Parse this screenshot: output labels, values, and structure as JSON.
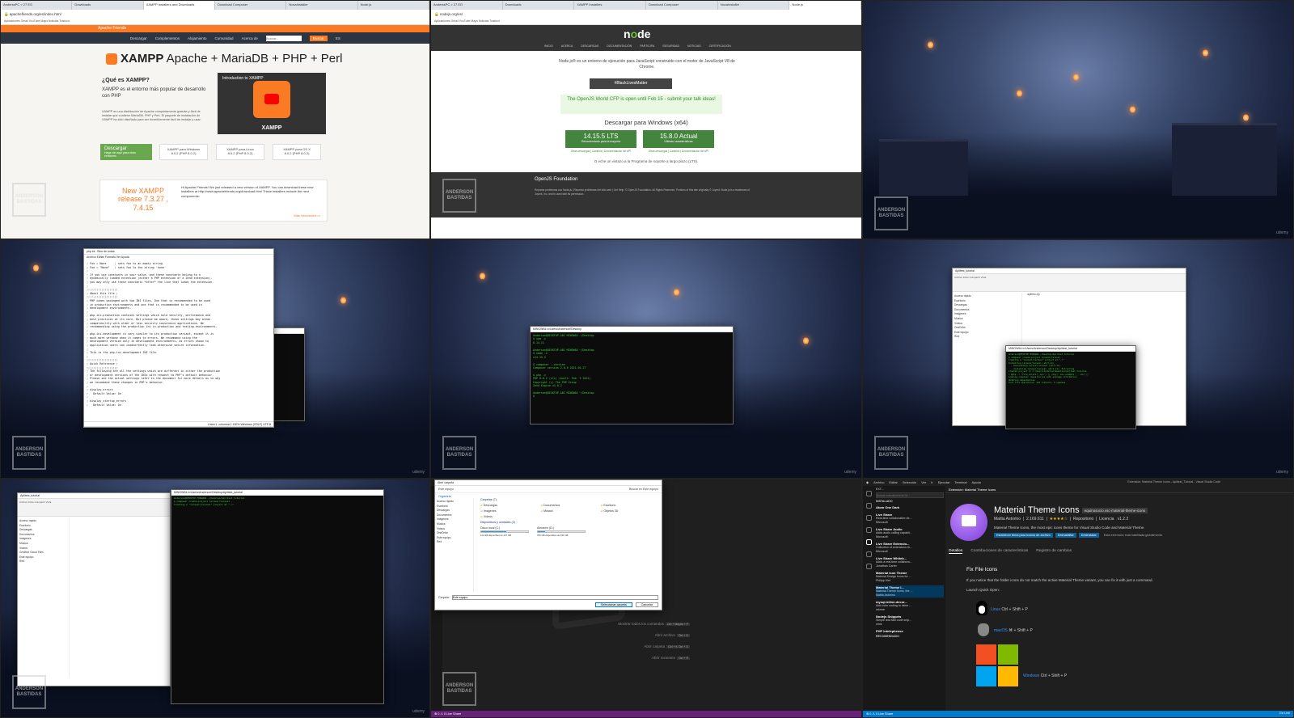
{
  "watermark": "ANDERSON BASTIDAS",
  "corner_brand": "udemy",
  "xampp": {
    "tabs": [
      "AnderssPC > 27 EG",
      "Downloads",
      "XAMPP Installers and Downloads",
      "Download Composer",
      "NovaInstaller",
      "Node.js"
    ],
    "url": "apachefriends.org/es/index.html",
    "bookmarks": "Aplicaciones  Gmail  YouTube  Maps  Noticias  Traducir",
    "top": "Apache Friends",
    "nav": [
      "Descargar",
      "Complementos",
      "Alojamiento",
      "Comunidad",
      "Acerca de"
    ],
    "search_placeholder": "Buscar...",
    "search_btn": "Buscar",
    "lang": "ES",
    "title_bold": "XAMPP",
    "title_rest": " Apache + MariaDB + PHP + Perl",
    "question": "¿Qué es XAMPP?",
    "lead": "XAMPP es el entorno más popular de desarrollo con PHP",
    "body": "XAMPP es una distribución de Apache completamente gratuita y fácil de instalar que contiene MariaDB, PHP y Perl. El paquete de instalación de XAMPP ha sido diseñado para ser increíblemente fácil de instalar y usar.",
    "video_title": "Introduction to XAMPP",
    "video_caption": "XAMPP",
    "download": "Descargar",
    "download_sub": "Haga clic aquí para otras versiones",
    "os": [
      {
        "name": "XAMPP para Windows",
        "ver": "8.0.2 (PHP 8.0.2)"
      },
      {
        "name": "XAMPP para Linux",
        "ver": "8.0.2 (PHP 8.0.2)"
      },
      {
        "name": "XAMPP para OS X",
        "ver": "8.0.2 (PHP 8.0.2)"
      }
    ],
    "release": "New XAMPP release 7.3.27 , 7.4.15",
    "news": "Hi Apache Friends! We just released a new version of XAMPP. You can download these new installers at http://www.apachefriends.org/download.html These installers include the next components:",
    "more": "Más información »"
  },
  "node": {
    "tabs": [
      "AnderssPC > 27 EG",
      "Downloads",
      "XAMPP Installers",
      "Download Composer",
      "NovaInstaller",
      "Node.js"
    ],
    "url": "nodejs.org/es/",
    "logo_a": "n",
    "logo_o": "o",
    "logo_b": "de",
    "nav": [
      "INICIO",
      "ACERCA",
      "DESCARGAS",
      "DOCUMENTACIÓN",
      "PARTICIPA",
      "SEGURIDAD",
      "NOTICIAS",
      "CERTIFICACIÓN"
    ],
    "desc": "Node.js® es un entorno de ejecución para JavaScript construido con el motor de JavaScript V8 de Chrome.",
    "blm": "#BlackLivesMatter",
    "banner": "The OpenJS World CFP is open until Feb 15 - submit your talk ideas!",
    "dl_title": "Descargar para Windows (x64)",
    "lts": "14.15.5 LTS",
    "lts_sub": "Recomendado para la mayoría",
    "cur": "15.8.0 Actual",
    "cur_sub": "Últimas características",
    "lts_links": "Otras descargas | Cambios | Documentación del API",
    "cur_links": "Otras descargas | Cambios | Documentación del API",
    "alt": "O eche un vistazo a la Programa de soporte a largo plazo (LTS).",
    "foot_brand": "OpenJS Foundation",
    "foot_text": "Reportar problemas con Node.js | Reportar problemas del sitio web | Get Help. © OpenJS Foundation. All Rights Reserved. Portions of this site originally © Joyent. Node.js is a trademark of Joyent, Inc. and is used with its permission."
  },
  "notepad": {
    "title": "php.ini - Bloc de notas",
    "menu": "Archivo  Editar  Formato  Ver  Ayuda",
    "lines": "; Foo = None     ; sets foo to an empty string\n; Foo = \"None\"   ; sets foo to the string 'none'\n;\n; If you use constants in your value, and these constants belong to a\n; dynamically loaded extension (either a PHP extension or a Zend extension),\n; you may only use these constants *after* the line that loads the extension.\n;\n;;;;;;;;;;;;;;;;;;;\n; About this file ;\n;;;;;;;;;;;;;;;;;;;\n; PHP comes packaged with two INI files. One that is recommended to be used\n; in production environments and one that is recommended to be used in\n; development environments.\n;\n; php.ini-production contains settings which hold security, performance and\n; best practices at its core. But please be aware, these settings may break\n; compatibility with older or less security conscience applications. We\n; recommending using the production ini in production and testing environments.\n;\n; php.ini-development is very similar to its production variant, except it is\n; much more verbose when it comes to errors. We recommend using the\n; development version only in development environments, as errors shown to\n; application users can inadvertently leak otherwise secure information.\n;\n; This is the php.ini-development INI file.\n;\n;;;;;;;;;;;;;;;;;;;\n; Quick Reference ;\n;;;;;;;;;;;;;;;;;;;\n; The following are all the settings which are different in either the production\n; or development versions of the INIs with respect to PHP's default behavior.\n; Please see the actual settings later in the document for more details as to why\n; we recommend these changes in PHP's behavior.\n;\n; display_errors\n;   Default Value: On\n;\n; display_startup_errors\n;   Default Value: On",
    "status": "Línea 1, columna 1     100%   Windows (CRLF)   UTF-8"
  },
  "term_center": {
    "title": "MINGW64:/c/Users/Anderson/Desktop",
    "lines": "Anderson@DESKTOP-ABC MINGW64 ~/Desktop\n$ npm -v\n6.14.11\n\nAnderson@DESKTOP-ABC MINGW64 ~/Desktop\n$ node -v\nv14.15.5\n\n$ composer --version\nComposer version 2.0.9 2021-01-27\n\n$ php -v\nPHP 8.0.2 (cli) (built: Feb  3 2021)\nCopyright (c) The PHP Group\nZend Engine v4.0.2\n\nAnderson@DESKTOP-ABC MINGW64 ~/Desktop\n$"
  },
  "explorer_right": {
    "title": "Aplitest_tutorial",
    "ribbon": "Archivo  Inicio  Compartir  Vista",
    "side": [
      "Acceso rápido",
      "Escritorio",
      "Descargas",
      "Documentos",
      "Imágenes",
      "Música",
      "Videos",
      "OneDrive",
      "Este equipo",
      "Red"
    ],
    "file": "aplitest.zip",
    "term_title": "MINGW64:/c/Users/Anderson/Desktop/Aplitest_tutorial",
    "term_lines": "Anderson@DESKTOP MINGW64 ~/Desktop/Aplitest_tutorial\n$ composer create-project laravel/laravel .\nCreating a \"laravel/laravel\" project at \"./\"\nInstalling laravel/laravel (v8.5.11)\n  - Downloading laravel/laravel (v8.5.11)\n  - Installing laravel/laravel (v8.5.11): Extracting\nCreated project in C:\\Users\\Anderson\\Desktop\\Aplitest_tutorial\n> @php -r \"file_exists('.env') || copy('.env.example', '.env');\"\nLoading composer repositories with package information\nUpdating dependencies\nLock file operations: 110 installs, 0 updates"
  },
  "explorer_bl": {
    "title": "Aplitest_tutorial",
    "side": [
      "Acceso rápido",
      "Escritorio",
      "Descargas",
      "Documentos",
      "Imágenes",
      "Música",
      "Videos",
      "Creative Cloud Files",
      "Este equipo",
      "Red"
    ],
    "term_title": "MINGW64:/c/Users/Anderson/Desktop/Aplitest_tutorial",
    "term_lines": "Anderson@DESKTOP MINGW64 ~/Desktop/Aplitest_tutorial\n$ composer create-project laravel/laravel .\nCreating a \"laravel/laravel\" project at \"./\""
  },
  "vscode_open": {
    "dialog_title": "Abrir carpeta",
    "address": "Este equipo",
    "search": "Buscar en Este equipo",
    "organize": "Organizar",
    "folders_head": "Carpetas (7)",
    "folders": [
      "Descargas",
      "Documentos",
      "Escritorio",
      "Imágenes",
      "Música",
      "Objetos 3D",
      "Vídeos"
    ],
    "drives_head": "Dispositivos y unidades (2)",
    "drives": [
      {
        "name": "Disco local (C:)",
        "free": "111 GB disponibles de 237 GB",
        "fill": 0.53
      },
      {
        "name": "Almacén (D:)",
        "free": "780 GB disponibles de 931 GB",
        "fill": 0.16
      }
    ],
    "folder_label": "Carpeta:",
    "folder_value": "Este equipo",
    "select": "Seleccionar carpeta",
    "cancel": "Cancelar",
    "hints": [
      {
        "label": "Mostrar todos los comandos",
        "keys": "Ctrl + Mayús + P"
      },
      {
        "label": "Abrir archivo",
        "keys": "Ctrl + O"
      },
      {
        "label": "Abrir carpeta",
        "keys": "Ctrl + K  Ctrl + O"
      },
      {
        "label": "Abrir recientes",
        "keys": "Ctrl + R"
      }
    ],
    "status": "⊗ 0 ⚠ 0   Live Share"
  },
  "vscode_ext": {
    "menu": [
      "Archivo",
      "Editar",
      "Selección",
      "Ver",
      "Ir",
      "Ejecutar",
      "Terminal",
      "Ayuda"
    ],
    "window_title": "Extensión: Material Theme Icons - Aplitest_Tutorial - Visual Studio Code",
    "side_title": "EXT...",
    "side_search": "Buscar extensiones en M...",
    "installed": "INSTALADO",
    "exts": [
      {
        "name": "Atom One Dark",
        "desc": "",
        "pub": ""
      },
      {
        "name": "Live Share",
        "desc": "Real-time collaborative de...",
        "pub": "Microsoft"
      },
      {
        "name": "Live Share Audio",
        "desc": "Adds audio calling capabil...",
        "pub": "Microsoft"
      },
      {
        "name": "Live Share Extensio...",
        "desc": "Collection of extensions th...",
        "pub": "Microsoft"
      },
      {
        "name": "Live Share Whiteb...",
        "desc": "Adds a real-time collabora...",
        "pub": "Jonathan Carter"
      },
      {
        "name": "Material Icon Theme",
        "desc": "Material Design Icons for ...",
        "pub": "Philipp Kief"
      },
      {
        "name": "Material Theme I...",
        "desc": "Material Theme Icons, the ...",
        "pub": "Mattia Astorino"
      },
      {
        "name": "mysql-inline-decor...",
        "desc": "Add color coding to inline ...",
        "pub": "mkmre"
      },
      {
        "name": "Nodejs Snippets",
        "desc": "Simple and fast code snip...",
        "pub": "chris"
      },
      {
        "name": "PHP Intelephense",
        "desc": "",
        "pub": ""
      }
    ],
    "recommended": "RECOMENDADO",
    "tab": "Extensión: Material Theme Icons",
    "name": "Material Theme Icons",
    "id": "equinusocio.vsc-material-theme-icons",
    "author": "Mattia Astorino",
    "installs": "2.169.611",
    "stars": "★★★★☆",
    "repo": "Repositorio",
    "license": "Licencia",
    "version": "v1.2.2",
    "desc": "Material Theme Icons, the most epic icons theme for Visual Studio Code and Material Theme.",
    "btns": [
      "Establecer tema para iconos de archivo",
      "Deshabilitar",
      "Desinstalar"
    ],
    "ext_note": "Esta extensión está habilitada globalmente.",
    "tabs": [
      "Detalles",
      "Contribuciones de características",
      "Registro de cambios"
    ],
    "h": "Fix File Icons",
    "p": "If you notice that the folder icons do not match the active Material Theme variant, you can fix it with just a command.",
    "quick": "Launch Quick Open:",
    "linux_os": "Linux",
    "linux_keys": "Ctrl + Shift + P",
    "mac_os": "macOS",
    "mac_keys": "⌘ + Shift + P",
    "win_os": "Windows",
    "win_keys": "Ctrl + Shift + P",
    "status": "⊗ 0 ⚠ 0   Live Share",
    "status_right": "Go Live"
  }
}
